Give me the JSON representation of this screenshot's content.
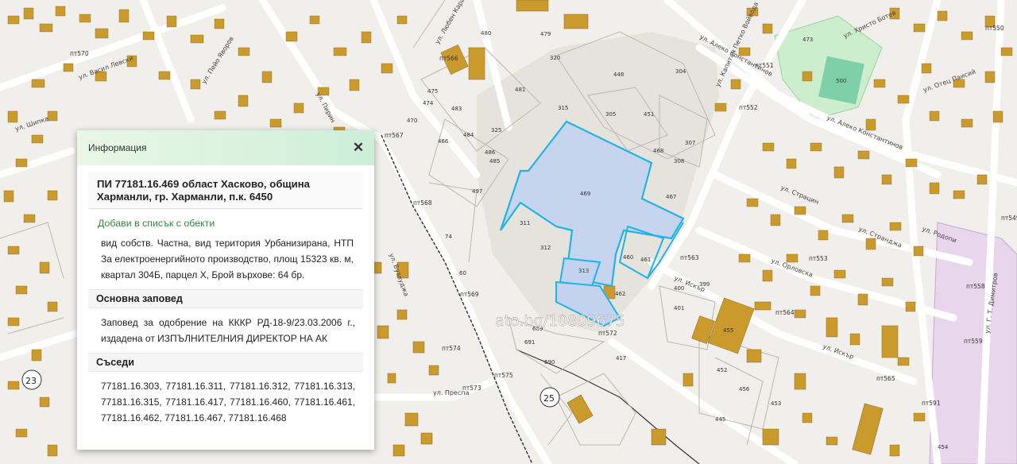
{
  "map": {
    "parcel_labels": [
      {
        "text": "479"
      },
      {
        "text": "320"
      },
      {
        "text": "480"
      },
      {
        "text": "481"
      },
      {
        "text": "315"
      },
      {
        "text": "448"
      },
      {
        "text": "304"
      },
      {
        "text": "305"
      },
      {
        "text": "451"
      },
      {
        "text": "307"
      },
      {
        "text": "325"
      },
      {
        "text": "468"
      },
      {
        "text": "308"
      },
      {
        "text": "467"
      },
      {
        "text": "469"
      },
      {
        "text": "311"
      },
      {
        "text": "312"
      },
      {
        "text": "313"
      },
      {
        "text": "460"
      },
      {
        "text": "461"
      },
      {
        "text": "462"
      },
      {
        "text": "483"
      },
      {
        "text": "484"
      },
      {
        "text": "466"
      },
      {
        "text": "486"
      },
      {
        "text": "485"
      },
      {
        "text": "497"
      },
      {
        "text": "470"
      },
      {
        "text": "475"
      },
      {
        "text": "474"
      },
      {
        "text": "473"
      },
      {
        "text": "500"
      },
      {
        "text": "691"
      },
      {
        "text": "689"
      },
      {
        "text": "690"
      },
      {
        "text": "417"
      },
      {
        "text": "455"
      },
      {
        "text": "452"
      },
      {
        "text": "445"
      },
      {
        "text": "401"
      },
      {
        "text": "400"
      },
      {
        "text": "399"
      },
      {
        "text": "453"
      },
      {
        "text": "456"
      },
      {
        "text": "454"
      },
      {
        "text": "74"
      },
      {
        "text": "60"
      }
    ],
    "point_labels": [
      {
        "text": "пт570"
      },
      {
        "text": "пт566"
      },
      {
        "text": "пт567"
      },
      {
        "text": "пт551"
      },
      {
        "text": "пт552"
      },
      {
        "text": "пт569"
      },
      {
        "text": "пт574"
      },
      {
        "text": "пт573"
      },
      {
        "text": "пт575"
      },
      {
        "text": "пт572"
      },
      {
        "text": "пт563"
      },
      {
        "text": "пт564"
      },
      {
        "text": "пт565"
      },
      {
        "text": "пт558"
      },
      {
        "text": "пт559"
      },
      {
        "text": "пт549"
      },
      {
        "text": "пт591"
      },
      {
        "text": "пт553"
      },
      {
        "text": "пт568"
      },
      {
        "text": "пт550"
      }
    ],
    "street_labels": [
      {
        "text": "ул. Алеко Константинов"
      },
      {
        "text": "ул. Алеко Константинов"
      },
      {
        "text": "ул. Христо Ботев"
      },
      {
        "text": "ул. Капитан Петко Войвода"
      },
      {
        "text": "ул. Отец Паисий"
      },
      {
        "text": "ул. Страцин"
      },
      {
        "text": "ул. Искър"
      },
      {
        "text": "ул. Орловска"
      },
      {
        "text": "ул. Искър"
      },
      {
        "text": "ул. Родопи"
      },
      {
        "text": "ул. Любен Каравелов"
      },
      {
        "text": "ул. Пейо Яворов"
      },
      {
        "text": "ул. Г. Т. Димитров"
      },
      {
        "text": "ул. Васил Левски"
      },
      {
        "text": "ул. Пирин"
      },
      {
        "text": "ул. Шипка"
      },
      {
        "text": "ул. Странджа"
      },
      {
        "text": "ул. Преспа"
      },
      {
        "text": "ул. Бузлуджа"
      }
    ],
    "quarter_numbers": [
      "23",
      "25"
    ],
    "watermark": "ato.bg/10809675",
    "colors": {
      "background": "#f2f0ec",
      "building": "#cc9a2a",
      "highlight_fill": "#c4d3ee",
      "highlight_stroke": "#1fb3e8",
      "greenery": "#c9efc8",
      "pink_zone": "#e8d6ec",
      "road": "#ffffff",
      "boundary": "#222222"
    }
  },
  "popup": {
    "header_title": "Информация",
    "close_icon": "close-icon",
    "pi_title": "ПИ 77181.16.469 област Хасково, община Харманли, гр. Харманли, п.к. 6450",
    "add_link": "Добави в списък с обекти",
    "details": "вид собств. Частна, вид територия Урбанизирана, НТП За електроенергийното производство, площ 15323 кв. м, квартал 304Б, парцел X, Брой върхове: 64 бр.",
    "order_heading": "Основна заповед",
    "order_text": "Заповед за одобрение на КККР РД-18-9/23.03.2006 г., издадена от ИЗПЪЛНИТЕЛНИЯ ДИРЕКТОР НА АК",
    "neighbors_heading": "Съседи",
    "neighbors_text": "77181.16.303, 77181.16.311, 77181.16.312, 77181.16.313, 77181.16.315, 77181.16.417, 77181.16.460, 77181.16.461, 77181.16.462, 77181.16.467, 77181.16.468"
  }
}
